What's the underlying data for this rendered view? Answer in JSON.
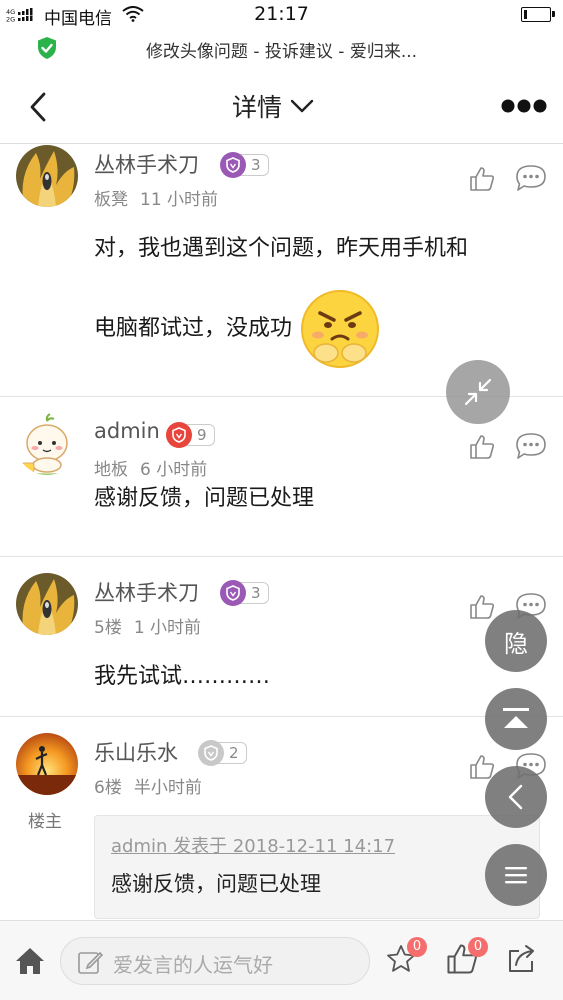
{
  "status_bar": {
    "network_top": "4G",
    "network_bottom": "2G",
    "carrier": "中国电信",
    "time": "21:17",
    "battery_level": 0.15
  },
  "url_bar": {
    "title": "修改头像问题 - 投诉建议 - 爱归来..."
  },
  "header": {
    "title": "详情"
  },
  "posts": [
    {
      "author": "丛林手术刀",
      "level": "3",
      "floor": "板凳",
      "time": "11 小时前",
      "content_line1": "对，我也遇到这个问题，昨天用手机和",
      "content_line2": "电脑都试过，没成功"
    },
    {
      "author": "admin",
      "level": "9",
      "floor": "地板",
      "time": "6 小时前",
      "content": "感谢反馈，问题已处理"
    },
    {
      "author": "丛林手术刀",
      "level": "3",
      "floor": "5楼",
      "time": "1 小时前",
      "content": "我先试试…………"
    },
    {
      "author": "乐山乐水",
      "level": "2",
      "floor": "6楼",
      "time": "半小时前",
      "owner_tag": "楼主",
      "quote_head": "admin 发表于 2018-12-11 14:17",
      "quote_body": "感谢反馈，问题已处理"
    }
  ],
  "floating": {
    "hide_label": "隐"
  },
  "bottom_bar": {
    "input_placeholder": "爱发言的人运气好",
    "favorite_count": "0",
    "like_count": "0"
  },
  "colors": {
    "badge_purple": "#9b59b6",
    "badge_red": "#e8453c",
    "badge_gray": "#c8c8c8",
    "notify_red": "#f56d6d",
    "shield_green": "#2cb24a"
  }
}
